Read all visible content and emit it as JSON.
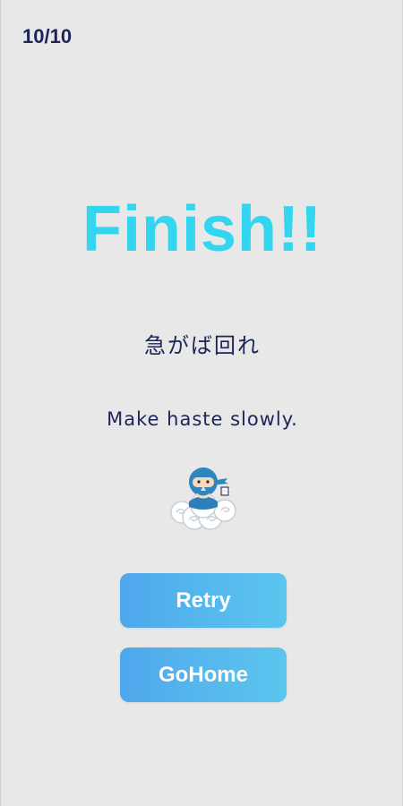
{
  "header": {
    "progress": "10/10"
  },
  "result": {
    "title": "Finish!!",
    "proverb_jp": "急がば回れ",
    "proverb_en": "Make haste slowly."
  },
  "mascot": {
    "icon": "ninja-on-cloud-icon"
  },
  "buttons": {
    "retry_label": "Retry",
    "home_label": "GoHome"
  },
  "colors": {
    "background": "#e8e8e8",
    "title": "#33d6ee",
    "text": "#1d2556",
    "button_start": "#4fa7ec",
    "button_end": "#5cc6ee"
  }
}
